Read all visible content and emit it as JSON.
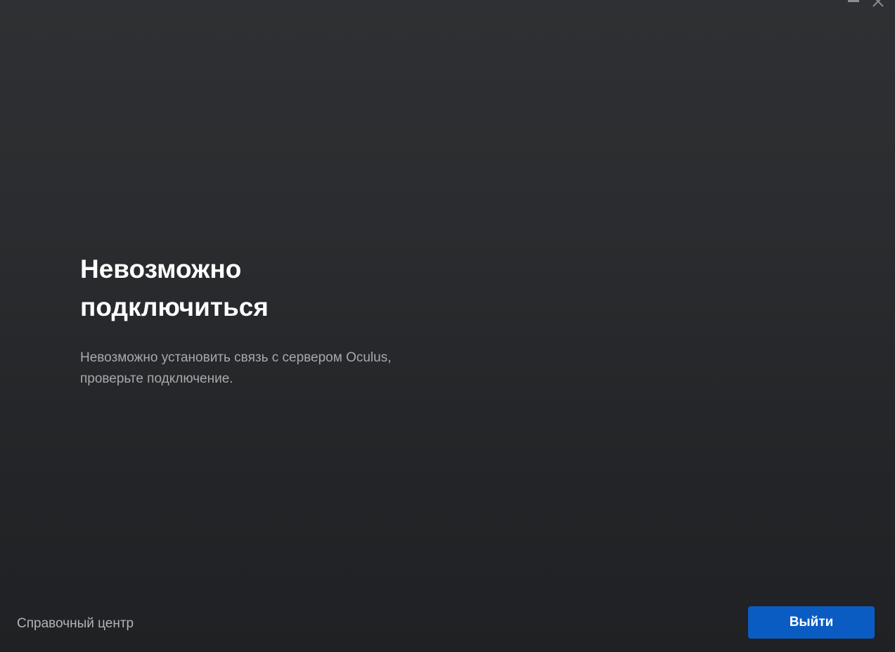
{
  "window_controls": {
    "minimize_icon": "minimize-icon",
    "close_icon": "close-icon"
  },
  "error": {
    "title": "Невозможно подключиться",
    "description": "Невозможно установить связь с сервером Oculus, проверьте подключение."
  },
  "footer": {
    "help_link_label": "Справочный центр",
    "exit_button_label": "Выйти"
  },
  "colors": {
    "background_top": "#2f3033",
    "background_bottom": "#1f2124",
    "accent_button": "#0b5cc2",
    "title_text": "#ffffff",
    "description_text": "#a7a9ad"
  }
}
